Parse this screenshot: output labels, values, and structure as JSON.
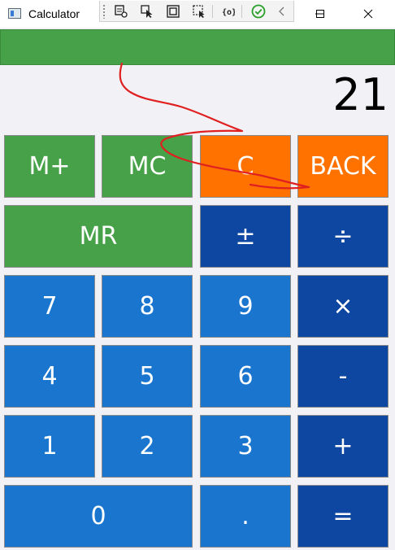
{
  "window": {
    "title": "Calculator",
    "minimize_glyph": "—",
    "maximize_glyph": "☐",
    "close_glyph": "✕"
  },
  "debug_toolbar": {
    "icons": [
      "select-element-icon",
      "pointer-icon",
      "display-layout-adorners-icon",
      "track-focus-icon",
      "binding-failures-icon",
      "xaml-hot-reload-icon",
      "collapse-icon"
    ]
  },
  "display": {
    "value": "21"
  },
  "keys": {
    "mplus": "M+",
    "mc": "MC",
    "clear": "C",
    "back": "BACK",
    "mr": "MR",
    "plusminus": "±",
    "divide": "÷",
    "seven": "7",
    "eight": "8",
    "nine": "9",
    "multiply": "×",
    "four": "4",
    "five": "5",
    "six": "6",
    "minus": "-",
    "one": "1",
    "two": "2",
    "three": "3",
    "plus": "+",
    "zero": "0",
    "dot": ".",
    "equals": "="
  },
  "colors": {
    "memory": "#47a148",
    "clear": "#ff7200",
    "digit": "#1a75cf",
    "operator": "#0e47a1",
    "annotation": "#e02020"
  }
}
